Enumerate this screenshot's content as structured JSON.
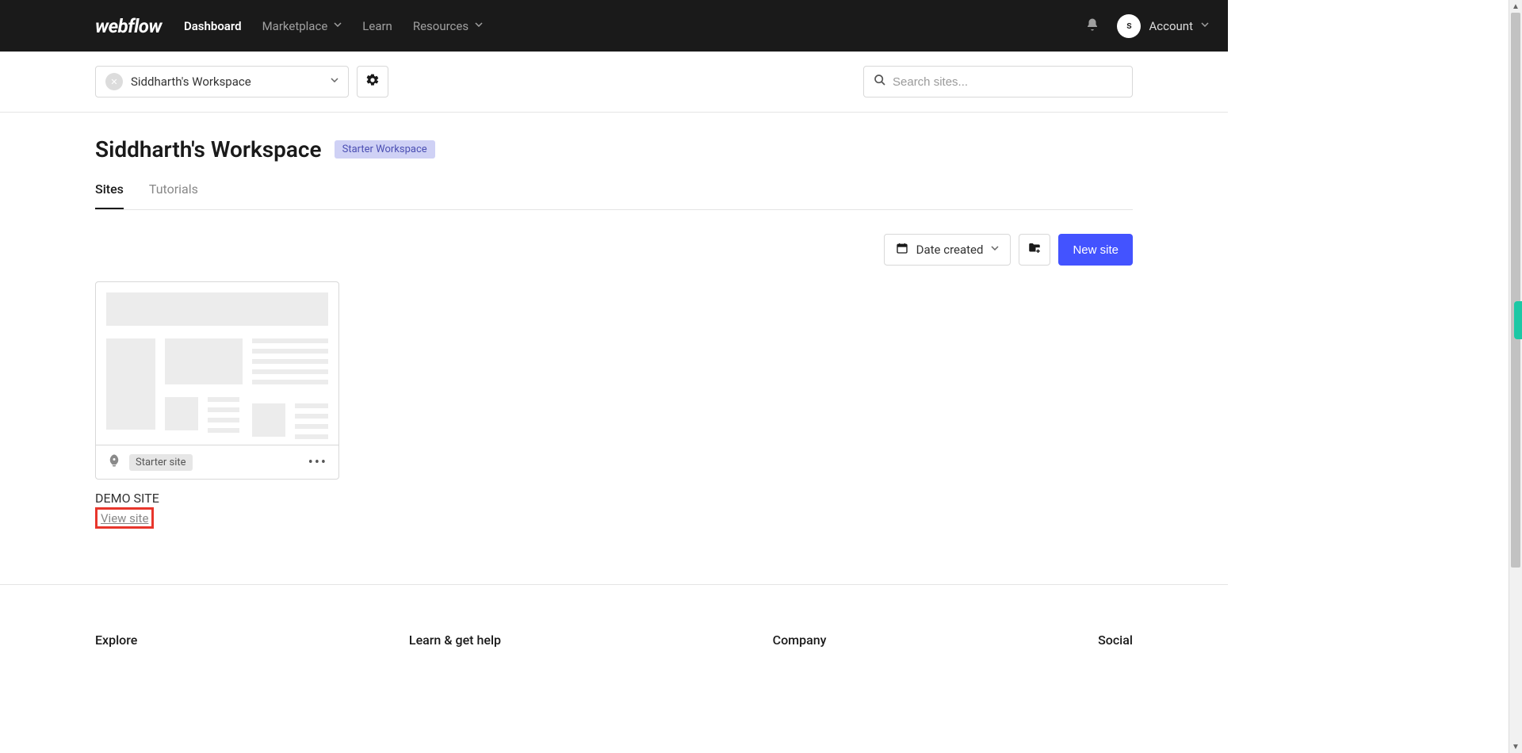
{
  "brand": "webflow",
  "nav": {
    "dashboard": "Dashboard",
    "marketplace": "Marketplace",
    "learn": "Learn",
    "resources": "Resources",
    "account": "Account",
    "avatar_initial": "s"
  },
  "workspace_selector": {
    "name": "Siddharth's Workspace"
  },
  "search": {
    "placeholder": "Search sites..."
  },
  "page": {
    "title": "Siddharth's Workspace",
    "badge": "Starter Workspace"
  },
  "tabs": {
    "sites": "Sites",
    "tutorials": "Tutorials"
  },
  "toolbar": {
    "sort_label": "Date created",
    "new_site": "New site"
  },
  "sites": [
    {
      "name": "DEMO SITE",
      "plan_badge": "Starter site",
      "view_link": "View site"
    }
  ],
  "footer": {
    "col1": "Explore",
    "col2": "Learn & get help",
    "col3": "Company",
    "col4": "Social"
  }
}
